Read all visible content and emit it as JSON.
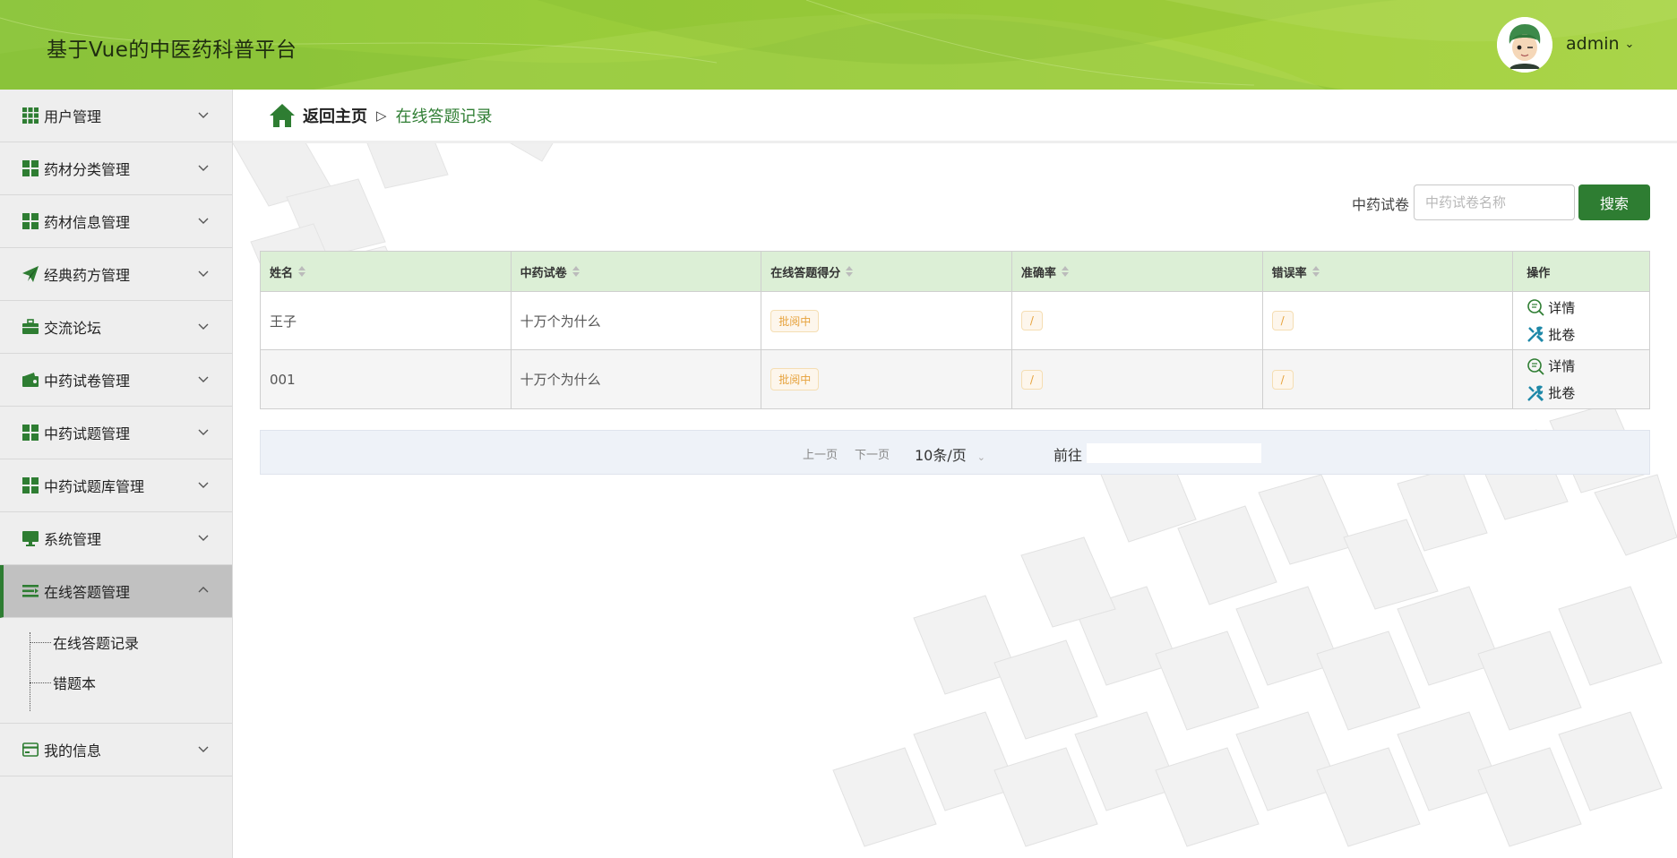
{
  "header": {
    "title": "基于Vue的中医药科普平台",
    "username": "admin"
  },
  "sidebar": {
    "items": [
      {
        "label": "用户管理",
        "icon": "grid-icon"
      },
      {
        "label": "药材分类管理",
        "icon": "tiles-icon"
      },
      {
        "label": "药材信息管理",
        "icon": "tiles-icon"
      },
      {
        "label": "经典药方管理",
        "icon": "paper-plane-icon"
      },
      {
        "label": "交流论坛",
        "icon": "briefcase-icon"
      },
      {
        "label": "中药试卷管理",
        "icon": "wallet-icon"
      },
      {
        "label": "中药试题管理",
        "icon": "tiles-icon"
      },
      {
        "label": "中药试题库管理",
        "icon": "tiles-icon"
      },
      {
        "label": "系统管理",
        "icon": "monitor-icon"
      },
      {
        "label": "在线答题管理",
        "icon": "list-icon"
      },
      {
        "label": "我的信息",
        "icon": "card-icon"
      }
    ],
    "submenu": [
      "在线答题记录",
      "错题本"
    ]
  },
  "breadcrumb": {
    "home": "返回主页",
    "separator": "▷",
    "current": "在线答题记录"
  },
  "search": {
    "label": "中药试卷",
    "placeholder": "中药试卷名称",
    "button": "搜索"
  },
  "table": {
    "columns": [
      "姓名",
      "中药试卷",
      "在线答题得分",
      "准确率",
      "错误率",
      "操作"
    ],
    "rows": [
      {
        "name": "王子",
        "paper": "十万个为什么",
        "score": "批阅中",
        "accuracy": "/",
        "error": "/"
      },
      {
        "name": "001",
        "paper": "十万个为什么",
        "score": "批阅中",
        "accuracy": "/",
        "error": "/"
      }
    ],
    "actions": {
      "detail": "详情",
      "grade": "批卷"
    }
  },
  "pagination": {
    "prev": "上一页",
    "next": "下一页",
    "page_size": "10条/页",
    "goto": "前往"
  },
  "colors": {
    "header_green": "#9acd3a",
    "primary": "#2e7d32",
    "table_header": "#dcefd6",
    "badge_text": "#e6a23c"
  }
}
